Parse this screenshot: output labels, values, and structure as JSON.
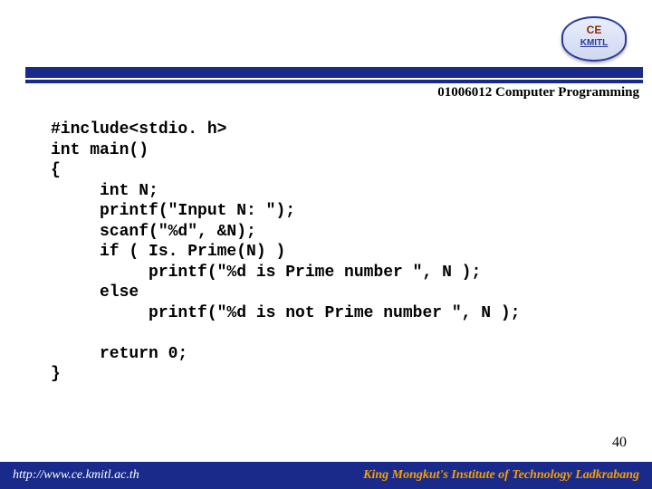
{
  "logo": {
    "line1": "CE",
    "line2": "KMITL"
  },
  "course_title": "01006012 Computer Programming",
  "code": "#include<stdio. h>\nint main()\n{\n     int N;\n     printf(\"Input N: \");\n     scanf(\"%d\", &N);\n     if ( Is. Prime(N) )\n          printf(\"%d is Prime number \", N );\n     else\n          printf(\"%d is not Prime number \", N );\n\n     return 0;\n}",
  "page_number": "40",
  "footer": {
    "url": "http://www.ce.kmitl.ac.th",
    "institute": "King Mongkut's Institute of Technology Ladkrabang"
  }
}
